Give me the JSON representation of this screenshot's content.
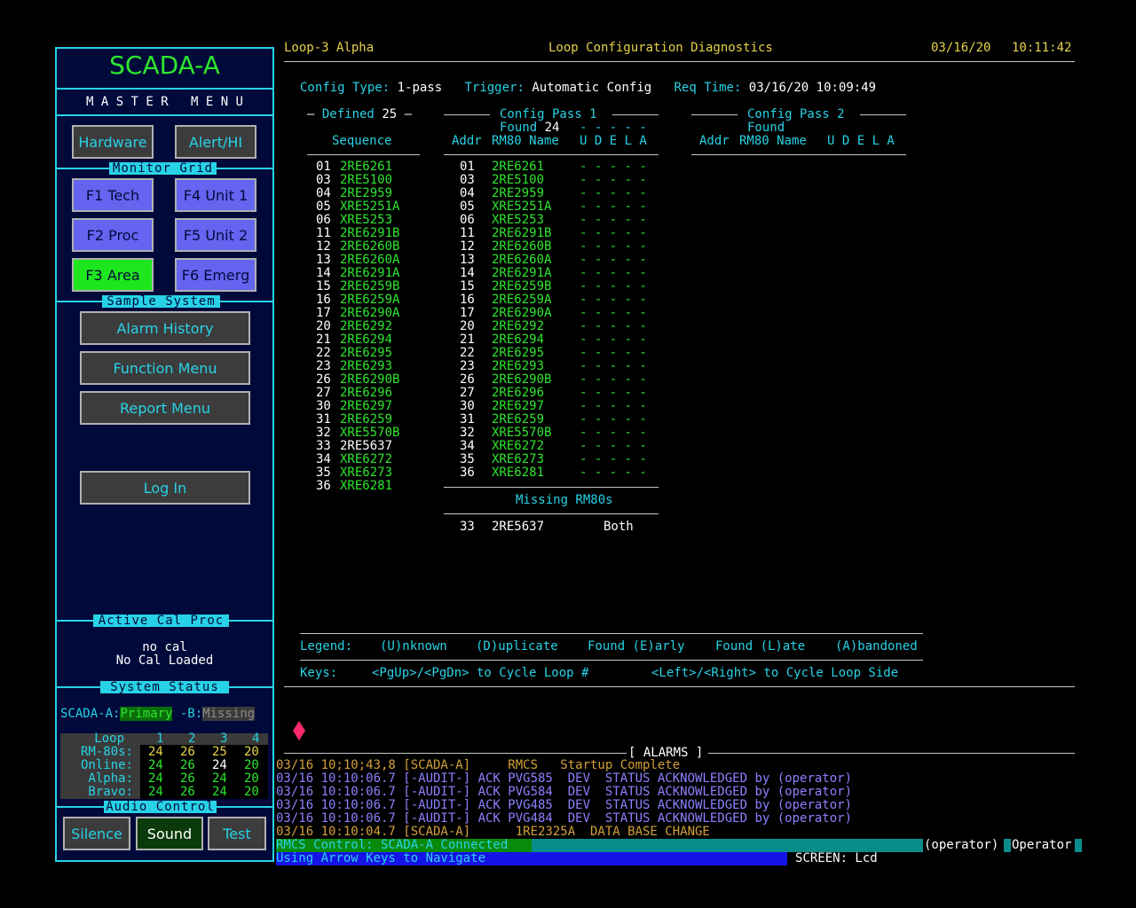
{
  "sidebar": {
    "title": "SCADA-A",
    "master_menu": "M A S T E R   M E N U",
    "hardware_btn": "Hardware",
    "alert_btn": "Alert/HI",
    "monitor_grid_label": "Monitor Grid",
    "f_buttons": [
      "F1 Tech",
      "F4 Unit 1",
      "F2 Proc",
      "F5 Unit 2",
      "F3 Area",
      "F6 Emerg"
    ],
    "sample_system_label": "Sample System",
    "alarm_history_btn": "Alarm History",
    "function_menu_btn": "Function Menu",
    "report_menu_btn": "Report Menu",
    "login_btn": "Log In",
    "active_cal_label": "Active Cal Proc",
    "no_cal": "no cal",
    "no_cal_loaded": "No Cal Loaded",
    "system_status_label": "System  Status",
    "scada_a": "SCADA-A:",
    "primary": "Primary",
    "b_label": " -B:",
    "missing": "Missing",
    "grid": {
      "header": [
        "Loop",
        "1",
        "2",
        "3",
        "4"
      ],
      "rows": [
        {
          "label": "RM-80s:",
          "v": [
            "24",
            "26",
            "25",
            "20"
          ]
        },
        {
          "label": "Online:",
          "v": [
            "24",
            "26",
            "24",
            "20"
          ]
        },
        {
          "label": "Alpha:",
          "v": [
            "24",
            "26",
            "24",
            "20"
          ]
        },
        {
          "label": "Bravo:",
          "v": [
            "24",
            "26",
            "24",
            "20"
          ]
        }
      ]
    },
    "audio_control_label": "Audio Control",
    "silence_btn": "Silence",
    "sound_btn": "Sound",
    "test_btn": "Test"
  },
  "header": {
    "loop": "Loop-3 Alpha",
    "title": "Loop Configuration Diagnostics",
    "date": "03/16/20",
    "time": "10:11:42"
  },
  "config": {
    "type_label": "Config Type:",
    "type_value": "1-pass",
    "trigger_label": "Trigger:",
    "trigger_value": "Automatic Config",
    "req_label": "Req Time:",
    "req_value": "03/16/20 10:09:49"
  },
  "defined": {
    "header": "Defined",
    "count": "25",
    "sequence": "Sequence",
    "rows": [
      [
        "01",
        "2RE6261"
      ],
      [
        "03",
        "2RE5100"
      ],
      [
        "04",
        "2RE2959"
      ],
      [
        "05",
        "XRE5251A"
      ],
      [
        "06",
        "XRE5253"
      ],
      [
        "11",
        "2RE6291B"
      ],
      [
        "12",
        "2RE6260B"
      ],
      [
        "13",
        "2RE6260A"
      ],
      [
        "14",
        "2RE6291A"
      ],
      [
        "15",
        "2RE6259B"
      ],
      [
        "16",
        "2RE6259A"
      ],
      [
        "17",
        "2RE6290A"
      ],
      [
        "20",
        "2RE6292"
      ],
      [
        "21",
        "2RE6294"
      ],
      [
        "22",
        "2RE6295"
      ],
      [
        "23",
        "2RE6293"
      ],
      [
        "26",
        "2RE6290B"
      ],
      [
        "27",
        "2RE6296"
      ],
      [
        "30",
        "2RE6297"
      ],
      [
        "31",
        "2RE6259"
      ],
      [
        "32",
        "XRE5570B"
      ],
      [
        "33",
        "2RE5637"
      ],
      [
        "34",
        "XRE6272"
      ],
      [
        "35",
        "XRE6273"
      ],
      [
        "36",
        "XRE6281"
      ]
    ]
  },
  "pass1": {
    "header": "Config Pass 1",
    "found_label": "Found",
    "found_count": "24",
    "col_addr": "Addr",
    "col_name": "RM80 Name",
    "col_flags": "U D E L A",
    "flags_blank": "- - - - -",
    "rows": [
      [
        "01",
        "2RE6261"
      ],
      [
        "03",
        "2RE5100"
      ],
      [
        "04",
        "2RE2959"
      ],
      [
        "05",
        "XRE5251A"
      ],
      [
        "06",
        "XRE5253"
      ],
      [
        "11",
        "2RE6291B"
      ],
      [
        "12",
        "2RE6260B"
      ],
      [
        "13",
        "2RE6260A"
      ],
      [
        "14",
        "2RE6291A"
      ],
      [
        "15",
        "2RE6259B"
      ],
      [
        "16",
        "2RE6259A"
      ],
      [
        "17",
        "2RE6290A"
      ],
      [
        "20",
        "2RE6292"
      ],
      [
        "21",
        "2RE6294"
      ],
      [
        "22",
        "2RE6295"
      ],
      [
        "23",
        "2RE6293"
      ],
      [
        "26",
        "2RE6290B"
      ],
      [
        "27",
        "2RE6296"
      ],
      [
        "30",
        "2RE6297"
      ],
      [
        "31",
        "2RE6259"
      ],
      [
        "32",
        "XRE5570B"
      ],
      [
        "34",
        "XRE6272"
      ],
      [
        "35",
        "XRE6273"
      ],
      [
        "36",
        "XRE6281"
      ]
    ],
    "missing_header": "Missing RM80s",
    "missing_rows": [
      [
        "33",
        "2RE5637",
        "Both"
      ]
    ]
  },
  "pass2": {
    "header": "Config Pass 2",
    "found_label": "Found",
    "col_addr": "Addr",
    "col_name": "RM80 Name",
    "col_flags": "U D E L A"
  },
  "legend": {
    "label": "Legend:",
    "items": [
      "(U)nknown",
      "(D)uplicate",
      "Found (E)arly",
      "Found (L)ate",
      "(A)bandoned"
    ]
  },
  "keys": {
    "label": "Keys:",
    "pg": "<PgUp>/<PgDn> to Cycle Loop #",
    "lr": "<Left>/<Right> to Cycle Loop Side"
  },
  "alarms": {
    "title": "[ ALARMS ]",
    "rows": [
      {
        "text": "03/16 10;10;43,8 [SCADA-A]     RMCS   Startup Complete",
        "color": "#d2a038"
      },
      {
        "text": "03/16 10:10:06.7 [-AUDIT-] ACK PVG585  DEV  STATUS ACKNOWLEDGED by (operator)",
        "color": "#8c80ff"
      },
      {
        "text": "03/16 10:10:06.7 [-AUDIT-] ACK PVG584  DEV  STATUS ACKNOWLEDGED by (operator)",
        "color": "#8c80ff"
      },
      {
        "text": "03/16 10:10:06.7 [-AUDIT-] ACK PVG485  DEV  STATUS ACKNOWLEDGED by (operator)",
        "color": "#8c80ff"
      },
      {
        "text": "03/16 10:10:06.7 [-AUDIT-] ACK PVG484  DEV  STATUS ACKNOWLEDGED by (operator)",
        "color": "#8c80ff"
      },
      {
        "text": "03/16 10:10:04.7 [SCADA-A]      1RE2325A  DATA BASE CHANGE",
        "color": "#d2a038"
      }
    ]
  },
  "statusbar": {
    "rmcs": "RMCS Control: SCADA-A Connected",
    "operator_paren": "(operator)",
    "operator": "Operator",
    "nav": "Using Arrow Keys to Navigate",
    "screen": "SCREEN: Lcd"
  },
  "colors": {
    "cyan": "#28d2e6",
    "yellow": "#e6d24a",
    "green": "#2ee62e",
    "f_button": "#6464f0",
    "f_button_active": "#1ee61e"
  }
}
